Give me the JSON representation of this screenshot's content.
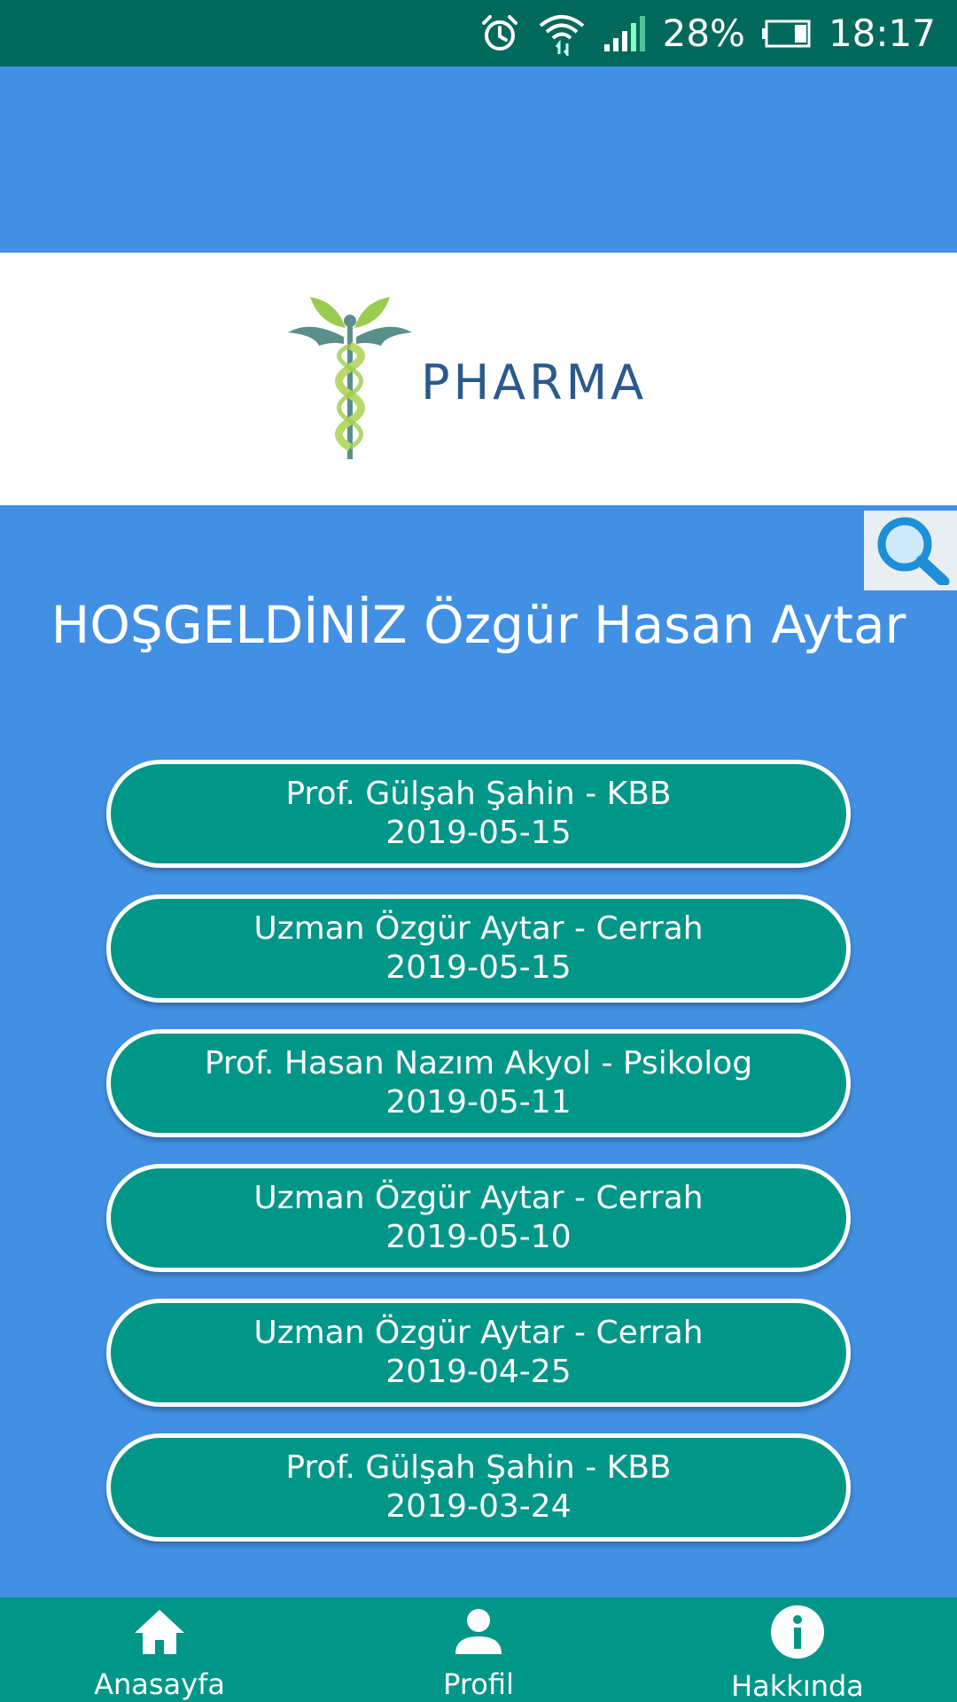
{
  "status_bar": {
    "battery": "28%",
    "time": "18:17",
    "icons": [
      "alarm-icon",
      "wifi-icon",
      "signal-icon",
      "battery-icon"
    ]
  },
  "logo": {
    "text": "PHARMA",
    "icon": "caduceus-icon"
  },
  "search": {
    "icon": "search-icon"
  },
  "welcome": "HOŞGELDİNİZ Özgür Hasan Aytar",
  "appointments": [
    {
      "title": "Prof. Gülşah Şahin - KBB",
      "date": "2019-05-15"
    },
    {
      "title": "Uzman Özgür Aytar - Cerrah",
      "date": "2019-05-15"
    },
    {
      "title": "Prof. Hasan Nazım Akyol - Psikolog",
      "date": "2019-05-11"
    },
    {
      "title": "Uzman Özgür Aytar - Cerrah",
      "date": "2019-05-10"
    },
    {
      "title": "Uzman Özgür Aytar - Cerrah",
      "date": "2019-04-25"
    },
    {
      "title": "Prof. Gülşah Şahin - KBB",
      "date": "2019-03-24"
    }
  ],
  "nav": [
    {
      "label": "Anasayfa",
      "icon": "home-icon"
    },
    {
      "label": "Profil",
      "icon": "person-icon"
    },
    {
      "label": "Hakkında",
      "icon": "info-icon"
    }
  ],
  "colors": {
    "status_bar": "#00695c",
    "background": "#4290e4",
    "button": "#009688",
    "nav": "#009688",
    "logo_text": "#2a5a8c"
  }
}
